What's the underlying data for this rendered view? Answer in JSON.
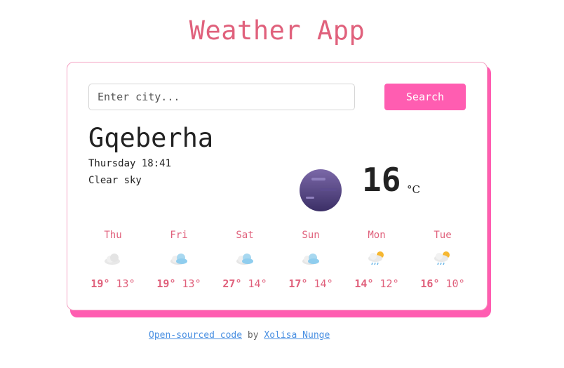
{
  "app": {
    "title": "Weather App"
  },
  "search": {
    "placeholder": "Enter city...",
    "value": "",
    "button_label": "Search"
  },
  "current": {
    "city": "Gqeberha",
    "datetime": "Thursday 18:41",
    "description": "Clear sky",
    "temperature": "16",
    "unit": "°C",
    "icon": "moon-icon"
  },
  "forecast": [
    {
      "day": "Thu",
      "max": "19°",
      "min": "13°",
      "icon": "cloud-icon"
    },
    {
      "day": "Fri",
      "max": "19°",
      "min": "13°",
      "icon": "cloud-icon"
    },
    {
      "day": "Sat",
      "max": "27°",
      "min": "14°",
      "icon": "cloud-icon"
    },
    {
      "day": "Sun",
      "max": "17°",
      "min": "14°",
      "icon": "cloud-icon"
    },
    {
      "day": "Mon",
      "max": "14°",
      "min": "12°",
      "icon": "sun-rain-icon"
    },
    {
      "day": "Tue",
      "max": "16°",
      "min": "10°",
      "icon": "sun-rain-icon"
    }
  ],
  "footer": {
    "link1": "Open-sourced code",
    "by": "by",
    "link2": "Xolisa Nunge"
  },
  "colors": {
    "accent": "#ff5db1",
    "title": "#e0617c",
    "link": "#4a90e2"
  }
}
